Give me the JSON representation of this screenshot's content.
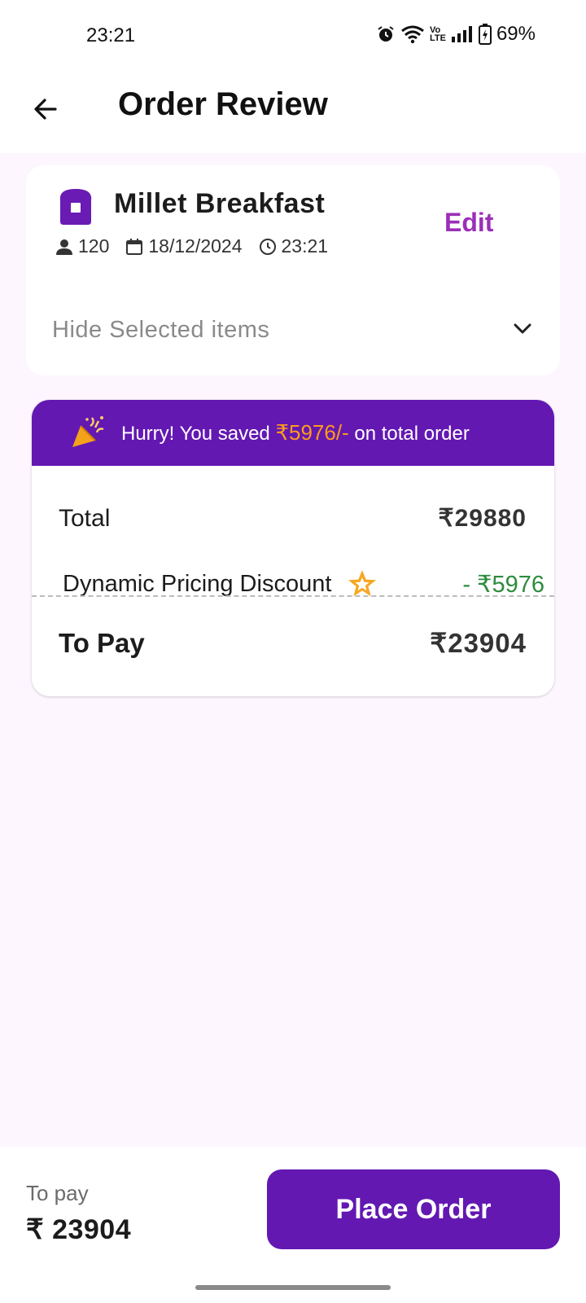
{
  "status_bar": {
    "time": "23:21",
    "battery": "69%",
    "icons": [
      "alarm-icon",
      "wifi-icon",
      "volte-icon",
      "signal-icon",
      "battery-icon"
    ]
  },
  "app_bar": {
    "title": "Order Review",
    "back_icon": "arrow-back-icon"
  },
  "order": {
    "title": "Millet Breakfast",
    "guests": "120",
    "date": "18/12/2024",
    "time": "23:21",
    "edit_label": "Edit",
    "toggle_label": "Hide Selected items"
  },
  "savings": {
    "prefix": "Hurry! You saved ",
    "amount": "₹5976/-",
    "suffix": " on total order"
  },
  "bill": {
    "total_label": "Total",
    "total_value": "₹29880",
    "discount_label": "Dynamic Pricing Discount",
    "discount_value": "- ₹5976",
    "topay_label": "To Pay",
    "topay_value": "₹23904"
  },
  "bottom": {
    "topay_label": "To pay",
    "topay_value": "₹ 23904",
    "button_label": "Place Order"
  },
  "colors": {
    "primary": "#6318b2",
    "edit": "#9b2fb8",
    "savings_accent": "#ff9a1a",
    "discount": "#2e8b3d",
    "background": "#fdf6ff"
  }
}
